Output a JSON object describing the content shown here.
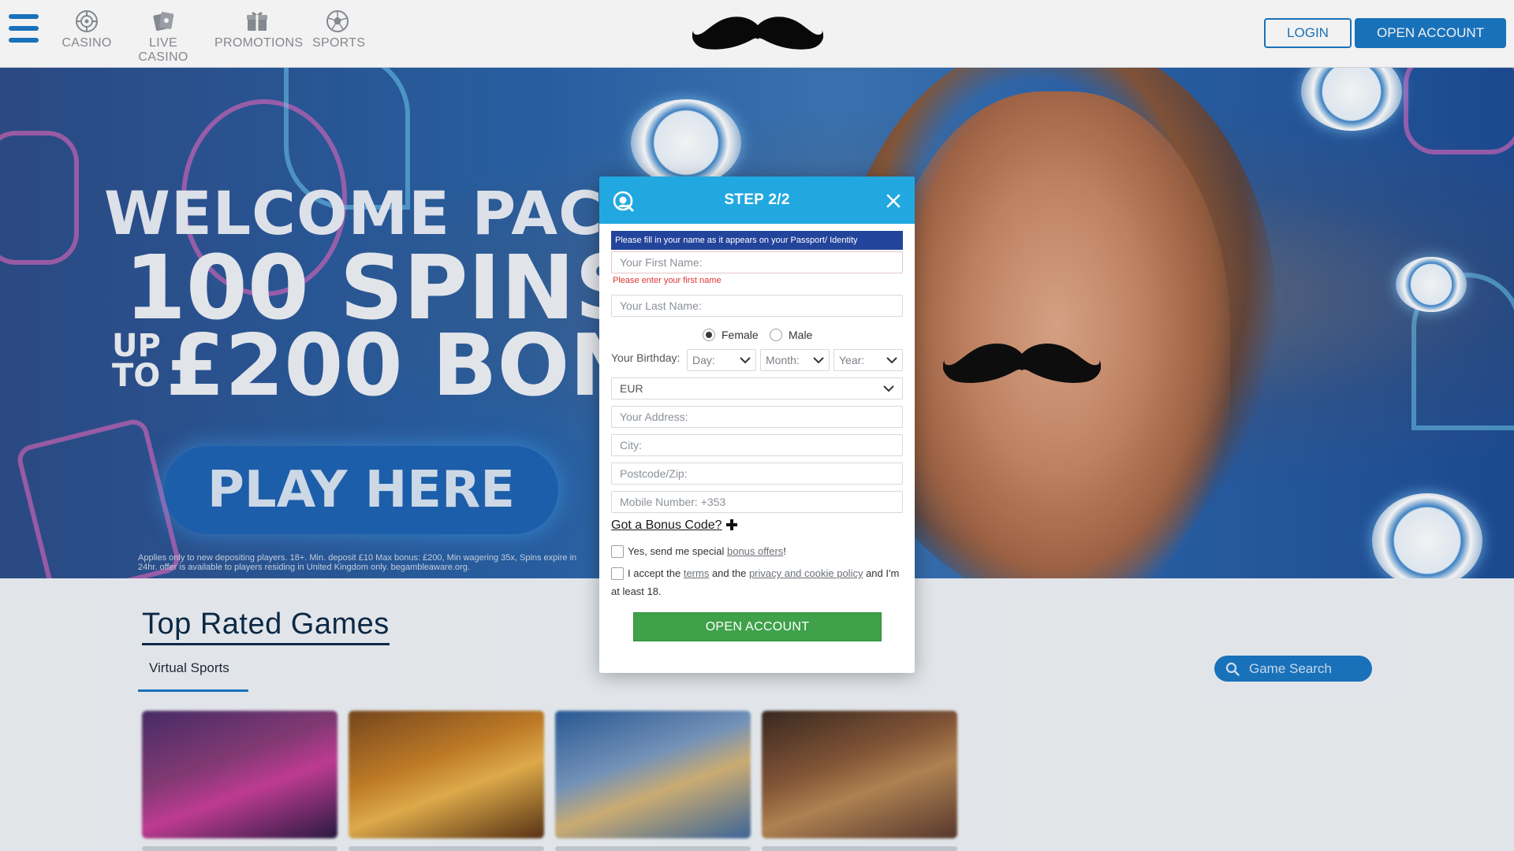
{
  "header": {
    "nav": [
      {
        "label": "CASINO",
        "icon": "roulette-icon"
      },
      {
        "label": "LIVE CASINO",
        "icon": "live-dealer-icon"
      },
      {
        "label": "PROMOTIONS",
        "icon": "gift-box-icon"
      },
      {
        "label": "SPORTS",
        "icon": "football-icon"
      }
    ],
    "login_label": "LOGIN",
    "open_account_label": "OPEN ACCOUNT"
  },
  "hero": {
    "line1": "WELCOME PACKAGE",
    "line2": "100 SPINS +",
    "up_to_top": "UP",
    "up_to_bottom": "TO",
    "line3": "£200 BONUS",
    "cta": "PLAY HERE",
    "terms": "Applies only to new depositing players. 18+. Min. deposit £10 Max bonus: £200, Min wagering 35x, Spins expire in 24hr. offer is available to players residing in United Kingdom only. begambleaware.org."
  },
  "games": {
    "title": "Top Rated Games",
    "tab": "Virtual Sports",
    "search_placeholder": "Game Search"
  },
  "modal": {
    "title": "STEP 2/2",
    "info": "Please fill in your name as it appears on your Passport/ Identity",
    "first_name_placeholder": "Your First Name:",
    "first_name_error": "Please enter your first name",
    "last_name_placeholder": "Your Last Name:",
    "gender_female": "Female",
    "gender_male": "Male",
    "gender_selected": "Female",
    "birthday_label": "Your Birthday:",
    "day_placeholder": "Day:",
    "month_placeholder": "Month:",
    "year_placeholder": "Year:",
    "currency": "EUR",
    "address_placeholder": "Your Address:",
    "city_placeholder": "City:",
    "postcode_placeholder": "Postcode/Zip:",
    "mobile_placeholder": "Mobile Number: +353",
    "bonus_code_label": "Got a Bonus Code?",
    "offers_text_pre": "Yes, send me special ",
    "offers_link": "bonus offers",
    "offers_text_post": "!",
    "accept_pre": "I accept the ",
    "terms_link": "terms",
    "accept_mid": " and the ",
    "privacy_link": "privacy and cookie policy",
    "accept_post": " and I'm at least 18.",
    "submit_label": "OPEN ACCOUNT"
  },
  "colors": {
    "brand_blue": "#1b78c4",
    "modal_header": "#22a8e0",
    "info_banner": "#23449b",
    "error_red": "#e03434",
    "submit_green": "#3fa14a"
  }
}
